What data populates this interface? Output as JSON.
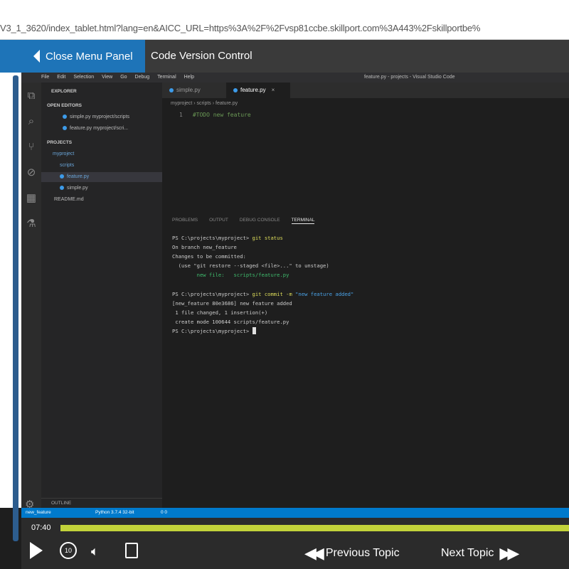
{
  "browser": {
    "url": "V3_1_3620/index_tablet.html?lang=en&AICC_URL=https%3A%2F%2Fvsp81ccbe.skillport.com%3A443%2Fskillportbe%"
  },
  "course": {
    "close_menu_label": "Close Menu Panel",
    "lesson_title": "Code Version Control"
  },
  "vscode": {
    "menu": [
      "File",
      "Edit",
      "Selection",
      "View",
      "Go",
      "Debug",
      "Terminal",
      "Help"
    ],
    "window_title": "feature.py - projects - Visual Studio Code",
    "explorer_title": "EXPLORER",
    "open_editors_header": "OPEN EDITORS",
    "open_editors": [
      "simple.py myproject/scripts",
      "feature.py myproject/scri..."
    ],
    "projects_header": "PROJECTS",
    "tree": [
      "myproject",
      "scripts",
      "feature.py",
      "simple.py",
      "README.md"
    ],
    "tabs": [
      "simple.py",
      "feature.py"
    ],
    "breadcrumb": "myproject › scripts › feature.py",
    "editor_line_number": "1",
    "editor_code": "#TODO new feature",
    "panel_tabs": [
      "PROBLEMS",
      "OUTPUT",
      "DEBUG CONSOLE",
      "TERMINAL"
    ],
    "terminal": {
      "prompt": "PS C:\\projects\\myproject>",
      "cmd1": "git status",
      "out1a": "On branch new_feature",
      "out1b": "Changes to be committed:",
      "out1c": "  (use \"git restore --staged <file>...\" to unstage)",
      "out1d": "        new file:   scripts/feature.py",
      "cmd2": "git commit -m",
      "cmd2_arg": "\"new feature added\"",
      "out2a": "[new_feature 80e3686] new feature added",
      "out2b": " 1 file changed, 1 insertion(+)",
      "out2c": " create mode 100644 scripts/feature.py"
    },
    "outline_label": "OUTLINE",
    "status": {
      "branch": "new_feature",
      "python": "Python 3.7.4 32-bit",
      "problems": "0  0"
    }
  },
  "player": {
    "time": "07:40",
    "progress_fraction": 1.0,
    "replay_label": "10",
    "prev_label": "Previous Topic",
    "next_label": "Next Topic"
  }
}
